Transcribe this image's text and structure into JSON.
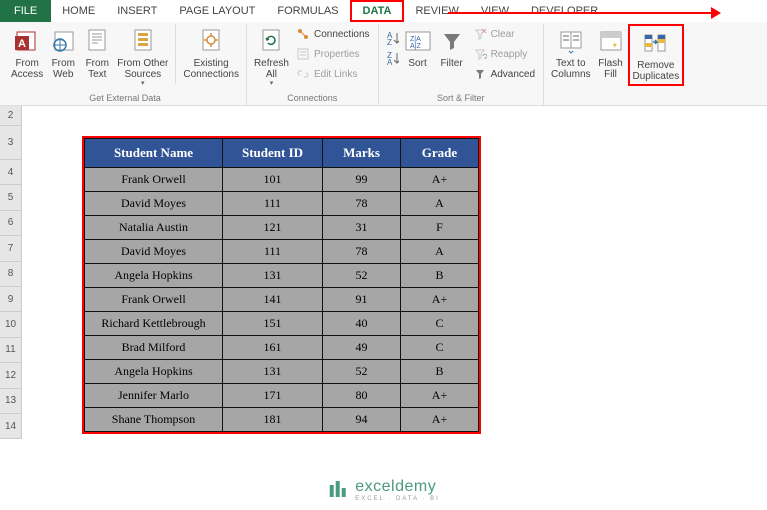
{
  "tabs": {
    "file": "FILE",
    "items": [
      "HOME",
      "INSERT",
      "PAGE LAYOUT",
      "FORMULAS",
      "DATA",
      "REVIEW",
      "VIEW",
      "DEVELOPER"
    ],
    "active_index": 4
  },
  "ribbon": {
    "groups": {
      "get_external": {
        "label": "Get External Data",
        "from_access": "From\nAccess",
        "from_web": "From\nWeb",
        "from_text": "From\nText",
        "from_other": "From Other\nSources",
        "existing": "Existing\nConnections"
      },
      "connections": {
        "label": "Connections",
        "refresh": "Refresh\nAll",
        "conns": "Connections",
        "props": "Properties",
        "edit_links": "Edit Links"
      },
      "sort_filter": {
        "label": "Sort & Filter",
        "sort": "Sort",
        "filter": "Filter",
        "clear": "Clear",
        "reapply": "Reapply",
        "advanced": "Advanced"
      },
      "data_tools": {
        "text_cols": "Text to\nColumns",
        "flash_fill": "Flash\nFill",
        "remove_dup": "Remove\nDuplicates"
      }
    }
  },
  "rows": [
    "2",
    "3",
    "4",
    "5",
    "6",
    "7",
    "8",
    "9",
    "10",
    "11",
    "12",
    "13",
    "14"
  ],
  "chart_data": {
    "type": "table",
    "headers": [
      "Student Name",
      "Student ID",
      "Marks",
      "Grade"
    ],
    "rows": [
      [
        "Frank Orwell",
        "101",
        "99",
        "A+"
      ],
      [
        "David Moyes",
        "111",
        "78",
        "A"
      ],
      [
        "Natalia Austin",
        "121",
        "31",
        "F"
      ],
      [
        "David Moyes",
        "111",
        "78",
        "A"
      ],
      [
        "Angela Hopkins",
        "131",
        "52",
        "B"
      ],
      [
        "Frank Orwell",
        "141",
        "91",
        "A+"
      ],
      [
        "Richard Kettlebrough",
        "151",
        "40",
        "C"
      ],
      [
        "Brad Milford",
        "161",
        "49",
        "C"
      ],
      [
        "Angela Hopkins",
        "131",
        "52",
        "B"
      ],
      [
        "Jennifer Marlo",
        "171",
        "80",
        "A+"
      ],
      [
        "Shane Thompson",
        "181",
        "94",
        "A+"
      ]
    ]
  },
  "logo": {
    "main": "exceldemy",
    "sub": "EXCEL · DATA · BI"
  }
}
